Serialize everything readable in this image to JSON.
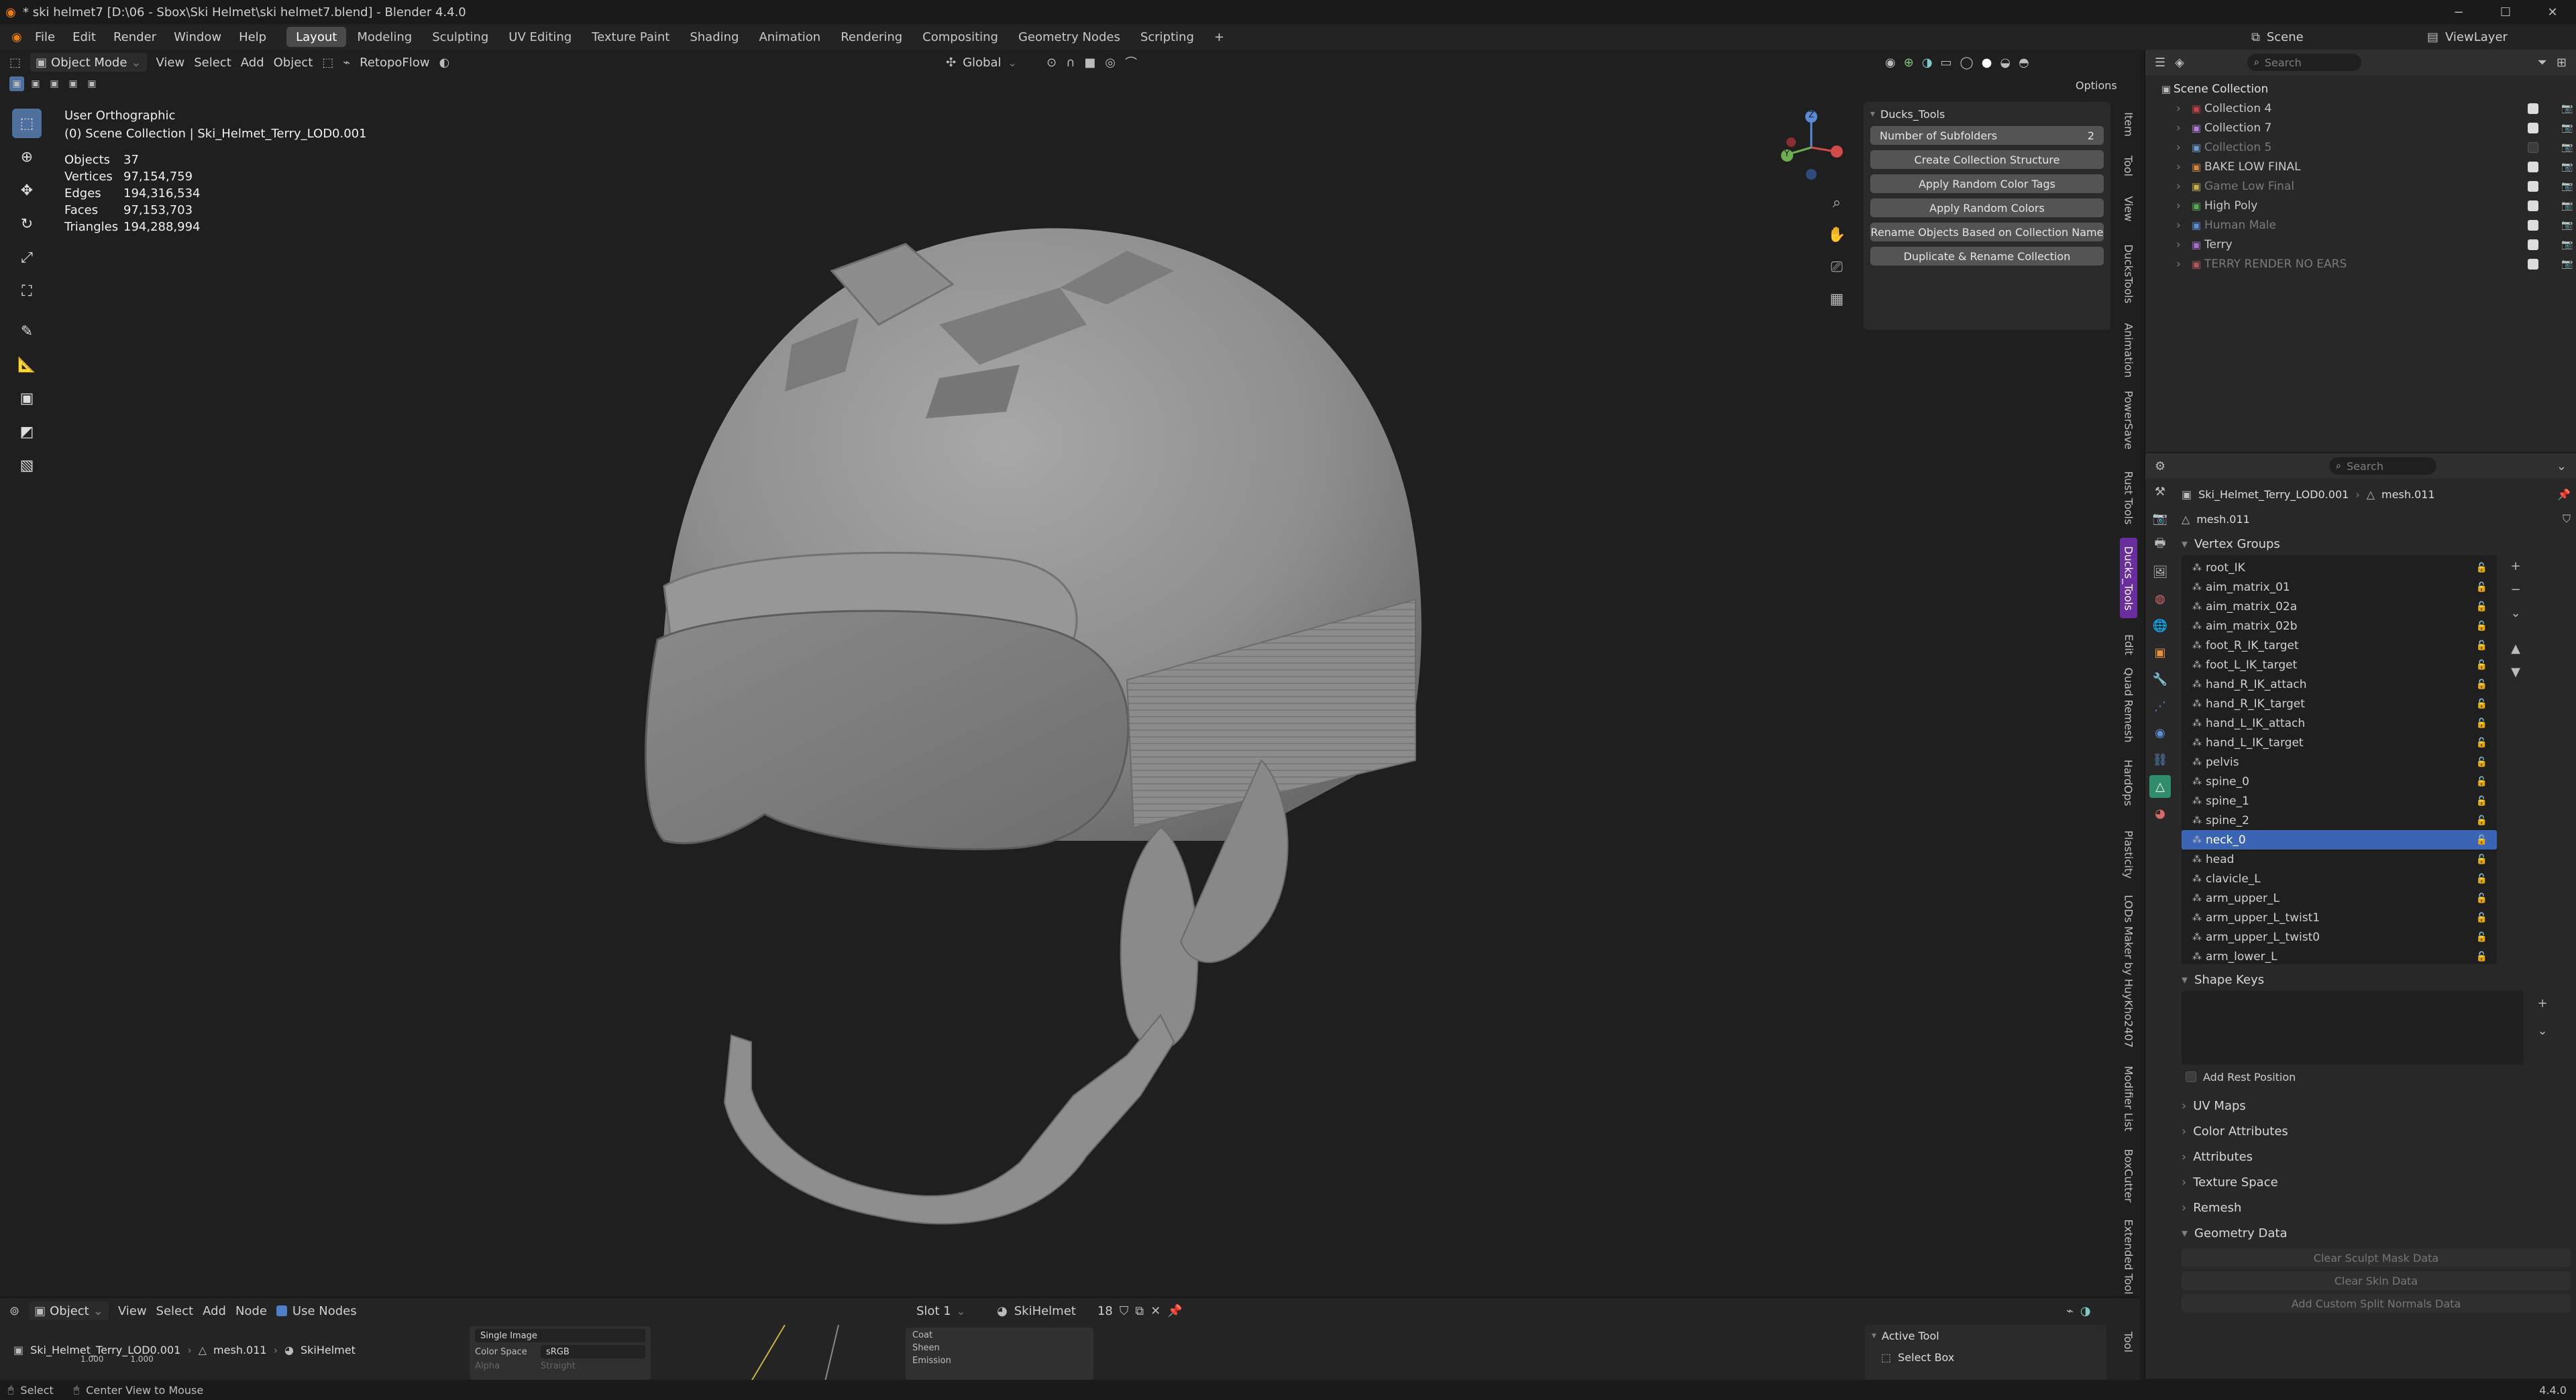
{
  "window": {
    "title": "* ski helmet7 [D:\\06 - Sbox\\Ski Helmet\\ski helmet7.blend] - Blender 4.4.0",
    "controls": [
      "−",
      "☐",
      "✕"
    ]
  },
  "menu": {
    "items": [
      "File",
      "Edit",
      "Render",
      "Window",
      "Help"
    ]
  },
  "workspaces": [
    "Layout",
    "Modeling",
    "Sculpting",
    "UV Editing",
    "Texture Paint",
    "Shading",
    "Animation",
    "Rendering",
    "Compositing",
    "Geometry Nodes",
    "Scripting",
    "+"
  ],
  "scene": {
    "label": "Scene",
    "viewlayer": "ViewLayer"
  },
  "viewport_header": {
    "mode": "Object Mode",
    "menus": [
      "View",
      "Select",
      "Add",
      "Object"
    ],
    "addon": "RetopoFlow",
    "orientation": "Global",
    "options": "Options"
  },
  "overlay": {
    "view_name": "User Orthographic",
    "collection_line": "(0) Scene Collection | Ski_Helmet_Terry_LOD0.001",
    "stats": [
      {
        "k": "Objects",
        "v": "37"
      },
      {
        "k": "Vertices",
        "v": "97,154,759"
      },
      {
        "k": "Edges",
        "v": "194,316,534"
      },
      {
        "k": "Faces",
        "v": "97,153,703"
      },
      {
        "k": "Triangles",
        "v": "194,288,994"
      }
    ]
  },
  "gizmo": {
    "z": "Z",
    "y": "Y"
  },
  "ducks": {
    "title": "Ducks_Tools",
    "subfolders_label": "Number of Subfolders",
    "subfolders_value": "2",
    "buttons": [
      "Create Collection Structure",
      "Apply Random Color Tags",
      "Apply Random Colors",
      "Rename Objects Based on Collection Name",
      "Duplicate & Rename Collection"
    ]
  },
  "side_tabs": [
    "Item",
    "Tool",
    "View",
    "DucksTools",
    "Animation",
    "PowerSave",
    "Rust Tools",
    "Ducks_Tools",
    "Edit",
    "Quad Remesh",
    "HardOps",
    "Plasticity",
    "LODs Maker by HuyKho2407",
    "Modifier List",
    "BoxCutter",
    "Extended Tool"
  ],
  "outliner": {
    "search": "Search",
    "root": "Scene Collection",
    "items": [
      {
        "name": "Collection 4",
        "color": "#c24343",
        "dim": false,
        "checked": true
      },
      {
        "name": "Collection 7",
        "color": "#b07ed0",
        "dim": false,
        "checked": true
      },
      {
        "name": "Collection 5",
        "color": "#6b9ad0",
        "dim": true,
        "checked": false
      },
      {
        "name": "BAKE LOW FINAL",
        "color": "#d08a3a",
        "dim": false,
        "checked": true
      },
      {
        "name": "Game Low Final",
        "color": "#c9b046",
        "dim": true,
        "checked": true
      },
      {
        "name": "High Poly",
        "color": "#53a954",
        "dim": false,
        "checked": true
      },
      {
        "name": "Human Male",
        "color": "#5a8fd6",
        "dim": true,
        "checked": true
      },
      {
        "name": "Terry",
        "color": "#a66fc8",
        "dim": false,
        "checked": true
      },
      {
        "name": "TERRY RENDER NO EARS",
        "color": "#b05858",
        "dim": true,
        "checked": true
      }
    ]
  },
  "properties": {
    "search": "Search",
    "object": "Ski_Helmet_Terry_LOD0.001",
    "mesh": "mesh.011",
    "mesh_name": "mesh.011",
    "vertex_groups_label": "Vertex Groups",
    "vertex_groups": [
      "root_IK",
      "aim_matrix_01",
      "aim_matrix_02a",
      "aim_matrix_02b",
      "foot_R_IK_target",
      "foot_L_IK_target",
      "hand_R_IK_attach",
      "hand_R_IK_target",
      "hand_L_IK_attach",
      "hand_L_IK_target",
      "pelvis",
      "spine_0",
      "spine_1",
      "spine_2",
      "neck_0",
      "head",
      "clavicle_L",
      "arm_upper_L",
      "arm_upper_L_twist1",
      "arm_upper_L_twist0",
      "arm_lower_L"
    ],
    "selected_index": 14,
    "shape_keys": "Shape Keys",
    "add_rest": "Add Rest Position",
    "sections": [
      "UV Maps",
      "Color Attributes",
      "Attributes",
      "Texture Space",
      "Remesh"
    ],
    "geometry_data": "Geometry Data",
    "geo_buttons": [
      "Clear Sculpt Mask Data",
      "Clear Skin Data",
      "Add Custom Split Normals Data"
    ]
  },
  "node_header": {
    "editor": "Object",
    "menus": [
      "View",
      "Select",
      "Add",
      "Node"
    ],
    "use_nodes": "Use Nodes",
    "slot": "Slot 1",
    "material": "SkiHelmet",
    "users": "18"
  },
  "node_breadcrumb": [
    "Ski_Helmet_Terry_LOD0.001",
    "mesh.011",
    "SkiHelmet"
  ],
  "node_image": {
    "type": "Single Image",
    "color_space_label": "Color Space",
    "color_space": "sRGB",
    "alpha_label": "Alpha",
    "alpha": "Straight",
    "x": "1.000",
    "y": "1.000"
  },
  "node_bsdf": [
    "Coat",
    "Sheen",
    "Emission"
  ],
  "active_tool": {
    "title": "Active Tool",
    "tool": "Select Box"
  },
  "status": {
    "left": "Select",
    "mid": "Center View to Mouse",
    "version": "4.4.0"
  }
}
